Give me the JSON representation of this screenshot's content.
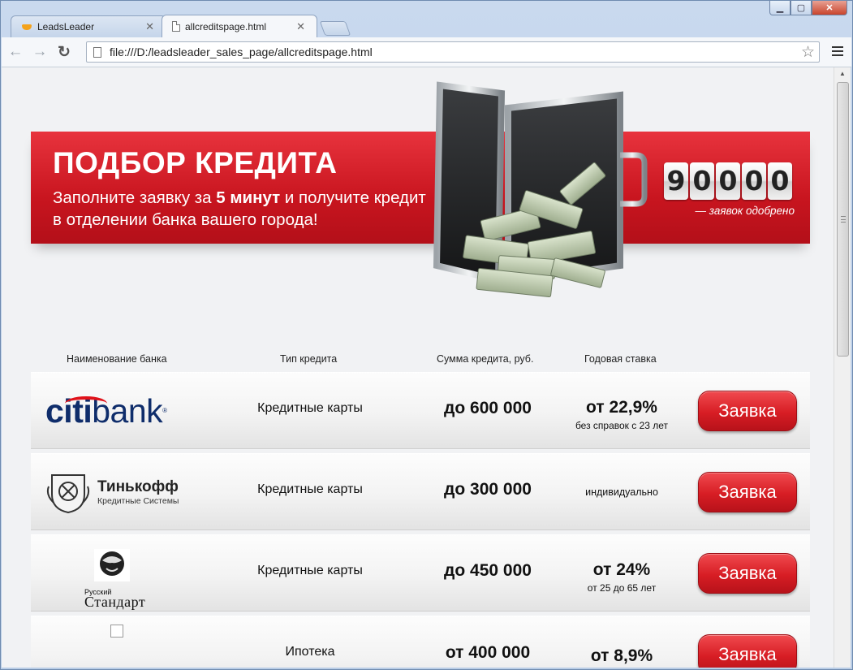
{
  "browser": {
    "tabs": [
      {
        "title": "LeadsLeader",
        "icon": "leadsleader-favicon",
        "active": false
      },
      {
        "title": "allcreditspage.html",
        "icon": "page-favicon",
        "active": true
      }
    ],
    "url": "file:///D:/leadsleader_sales_page/allcreditspage.html"
  },
  "banner": {
    "title": "ПОДБОР КРЕДИТА",
    "subtitle_part1": "Заполните заявку за ",
    "subtitle_bold": "5 минут",
    "subtitle_part2": " и получите кредит в отделении банка вашего города!",
    "counter_digits": [
      "9",
      "0",
      "0",
      "0",
      "0"
    ],
    "counter_caption": "— заявок одобрено"
  },
  "table": {
    "headers": {
      "bank": "Наименование банка",
      "type": "Тип кредита",
      "amount": "Сумма кредита, руб.",
      "rate": "Годовая ставка"
    },
    "rows": [
      {
        "bank": "citibank",
        "type": "Кредитные карты",
        "amount": "до 600 000",
        "rate": "от 22,9%",
        "rate_note": "без справок с 23 лет",
        "button": "Заявка"
      },
      {
        "bank": "Тинькофф",
        "bank_sub": "Кредитные Системы",
        "type": "Кредитные карты",
        "amount": "до 300 000",
        "rate": "индивидуально",
        "rate_note": "",
        "button": "Заявка"
      },
      {
        "bank_small": "Русский",
        "bank": "Стандарт",
        "type": "Кредитные карты",
        "amount": "до 450 000",
        "rate": "от 24%",
        "rate_note": "от 25 до 65 лет",
        "button": "Заявка"
      },
      {
        "bank": "",
        "type": "Ипотека",
        "amount": "от 400 000",
        "rate": "от 8,9%",
        "rate_note": "",
        "button": "Заявка"
      }
    ]
  },
  "colors": {
    "brand_red": "#d71d24",
    "citi_blue": "#0f2d6b",
    "citi_red": "#e0121a"
  }
}
